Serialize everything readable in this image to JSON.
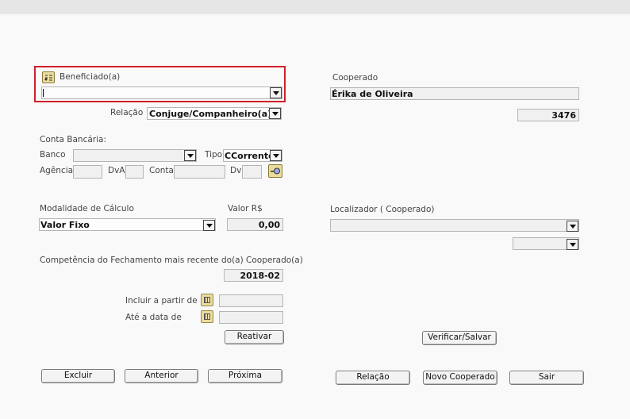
{
  "beneficiado": {
    "label": "Beneficiado(a)",
    "value": ""
  },
  "relacao": {
    "label": "Relação",
    "value": "Conjuge/Companheiro(a)"
  },
  "conta_bancaria": {
    "title": "Conta Bancária:",
    "banco_label": "Banco",
    "tipo_label": "Tipo",
    "tipo_value": "CCorrente",
    "agencia_label": "Agência",
    "dva_label": "DvA",
    "conta_label": "Conta",
    "dv_label": "Dv"
  },
  "calculo": {
    "modalidade_label": "Modalidade de Cálculo",
    "modalidade_value": "Valor Fixo",
    "valor_label": "Valor R$",
    "valor_value": "0,00"
  },
  "competencia": {
    "label": "Competência do Fechamento mais recente do(a) Cooperado(a)",
    "value": "2018-02"
  },
  "datas": {
    "incluir_label": "Incluir a partir de",
    "ate_label": "Até a data de"
  },
  "cooperado": {
    "label": "Cooperado",
    "name": "Érika de Oliveira",
    "code": "3476"
  },
  "localizador": {
    "label": "Localizador ( Cooperado)"
  },
  "buttons": {
    "reativar": "Reativar",
    "verificar_salvar": "Verificar/Salvar",
    "excluir": "Excluir",
    "anterior": "Anterior",
    "proxima": "Próxima",
    "relacao": "Relação",
    "novo_cooperado": "Novo Cooperado",
    "sair": "Sair"
  }
}
